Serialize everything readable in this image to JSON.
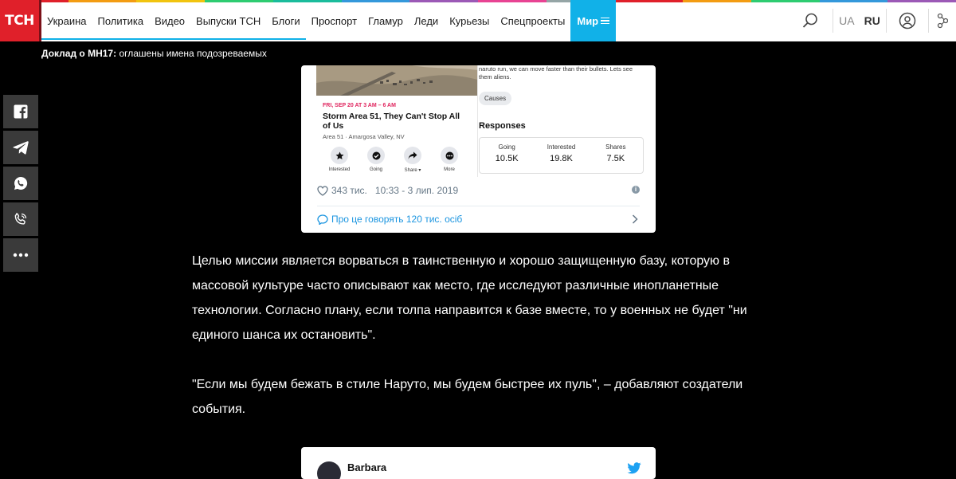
{
  "brand": {
    "logo_text": "ТСН"
  },
  "nav": {
    "items": [
      "Украина",
      "Политика",
      "Видео",
      "Выпуски ТСН",
      "Блоги",
      "Проспорт",
      "Гламур",
      "Леди",
      "Курьезы",
      "Спецпроекты"
    ],
    "active_item": "Мир"
  },
  "tools": {
    "lang_ua": "UA",
    "lang_ru": "RU"
  },
  "headline": {
    "bold": "Доклад о МН17:",
    "rest": " оглашены имена подозреваемых"
  },
  "share_icons": [
    "facebook-icon",
    "telegram-icon",
    "whatsapp-icon",
    "viber-icon",
    "more-icon"
  ],
  "tweet1": {
    "event_top_text": "naruto run, we can move faster than their bullets. Lets see them aliens.",
    "event_date": "FRI, SEP 20 AT 3 AM – 6 AM",
    "event_title": "Storm Area 51, They Can't Stop All of Us",
    "event_location": "Area 51 · Amargosa Valley, NV",
    "actions": [
      "Interested",
      "Going",
      "Share ▾",
      "More"
    ],
    "chip": "Causes",
    "responses_title": "Responses",
    "responses": [
      {
        "label": "Going",
        "value": "10.5K"
      },
      {
        "label": "Interested",
        "value": "19.8K"
      },
      {
        "label": "Shares",
        "value": "7.5K"
      }
    ],
    "likes": "343 тис.",
    "time": "10:33 - 3 лип. 2019",
    "talking": "Про це говорять 120 тис. осіб"
  },
  "article": {
    "p1": "Целью миссии является ворваться в таинственную и хорошо защищенную базу, которую в массовой культуре часто описывают как место, где исследуют различные инопланетные технологии. Согласно плану, если толпа направится к базе вместе, то у военных не будет \"ни единого шанса их остановить\".",
    "p2": "\"Если мы будем бежать в стиле Наруто, мы будем быстрее их пуль\", – добавляют создатели события."
  },
  "tweet2": {
    "name": "Barbara"
  },
  "colors": {
    "logo_red": "#e0202a",
    "active_nav": "#11b1e8",
    "twitter_blue": "#1b95e0",
    "share_bg": "#3a3a3a",
    "strip": [
      "#e0202a",
      "#f39c12",
      "#f1c40f",
      "#2ecc71",
      "#1abc9c",
      "#3498db",
      "#9b59b6",
      "#e84393",
      "#95a5a6",
      "#e0202a",
      "#f39c12",
      "#2ecc71",
      "#3498db",
      "#9b59b6"
    ]
  }
}
